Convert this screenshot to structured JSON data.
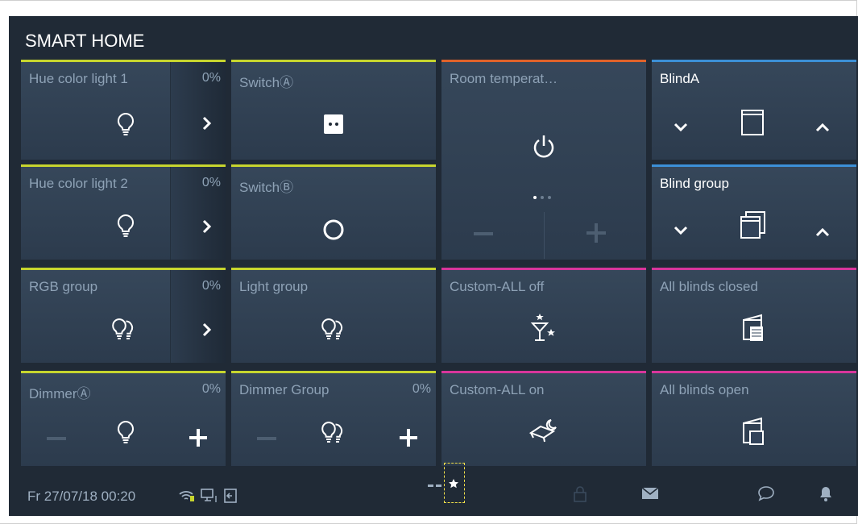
{
  "title": "SMART HOME",
  "tiles": [
    {
      "label": "Hue color light 1",
      "value": "0%",
      "accent": "#c7d52e"
    },
    {
      "label": "SwitchⒶ",
      "accent": "#c7d52e"
    },
    {
      "label": "Room temperat…",
      "accent": "#e0622a"
    },
    {
      "label": "BlindA",
      "accent": "#3c8fd6"
    },
    {
      "label": "Hue color light 2",
      "value": "0%",
      "accent": "#c7d52e"
    },
    {
      "label": "SwitchⒷ",
      "accent": "#c7d52e"
    },
    {
      "label": "Blind group",
      "accent": "#3c8fd6"
    },
    {
      "label": "RGB group",
      "value": "0%",
      "accent": "#c7d52e"
    },
    {
      "label": "Light group",
      "accent": "#c7d52e"
    },
    {
      "label": "Custom-ALL off",
      "accent": "#d8359b"
    },
    {
      "label": "All blinds closed",
      "accent": "#d8359b"
    },
    {
      "label": "DimmerⒶ",
      "value": "0%",
      "accent": "#c7d52e"
    },
    {
      "label": "Dimmer Group",
      "value": "0%",
      "accent": "#c7d52e"
    },
    {
      "label": "Custom-ALL on",
      "accent": "#d8359b"
    },
    {
      "label": "All blinds open",
      "accent": "#d8359b"
    }
  ],
  "status": {
    "datetime": "Fr 27/07/18  00:20"
  },
  "icons": [
    "bulb-icon",
    "chevron-right-icon",
    "switch-icon",
    "power-icon",
    "minus-icon",
    "plus-icon",
    "chevron-down-icon",
    "chevron-up-icon",
    "blind-icon",
    "blind-group-icon",
    "bulb-group-icon",
    "scene-party-icon",
    "scene-night-icon",
    "blinds-closed-icon",
    "blinds-open-icon",
    "wifi-icon",
    "network-icon",
    "logout-icon",
    "lock-icon",
    "mail-icon",
    "chat-icon",
    "bell-icon",
    "star-icon"
  ]
}
